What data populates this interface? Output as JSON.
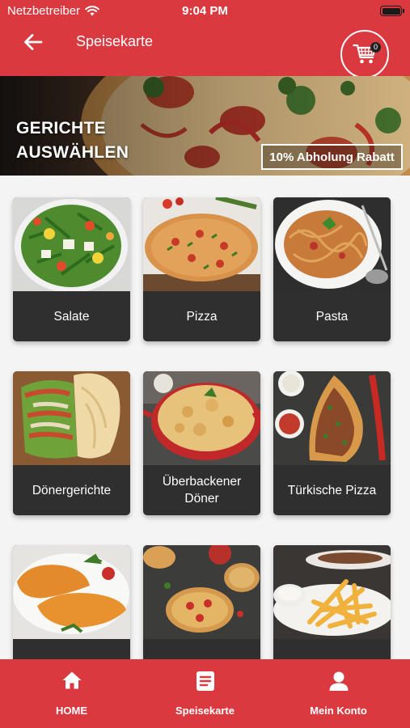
{
  "status_bar": {
    "carrier": "Netzbetreiber",
    "time": "9:04 PM",
    "wifi_icon": "wifi-icon",
    "battery_icon": "battery-icon"
  },
  "header": {
    "back_icon": "arrow-left-icon",
    "title": "Speisekarte",
    "cart_icon": "shopping-cart-icon",
    "cart_count": "0"
  },
  "banner": {
    "title_line1": "GERICHTE",
    "title_line2": "AUSWÄHLEN",
    "discount": "10% Abholung Rabatt"
  },
  "categories": [
    {
      "label": "Salate"
    },
    {
      "label": "Pizza"
    },
    {
      "label": "Pasta"
    },
    {
      "label": "Dönergerichte"
    },
    {
      "label": "Überbackener Döner"
    },
    {
      "label": "Türkische Pizza"
    },
    {
      "label": ""
    },
    {
      "label": ""
    },
    {
      "label": ""
    }
  ],
  "bottom_nav": [
    {
      "label": "HOME",
      "icon": "home-icon"
    },
    {
      "label": "Speisekarte",
      "icon": "menu-list-icon"
    },
    {
      "label": "Mein Konto",
      "icon": "user-icon"
    }
  ],
  "colors": {
    "brand_red": "#da3a3f",
    "tile_dark": "#2f2f2f",
    "text_white": "#ffffff"
  }
}
